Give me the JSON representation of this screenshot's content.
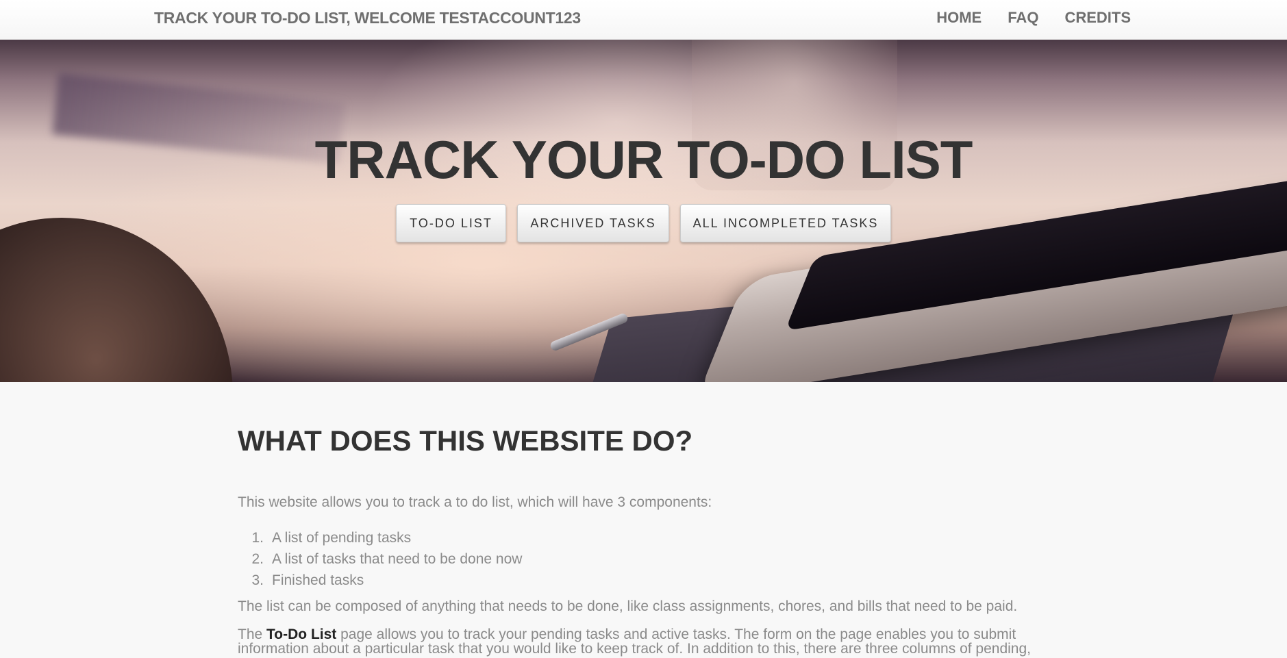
{
  "navbar": {
    "brand": "TRACK YOUR TO-DO LIST, WELCOME TESTACCOUNT123",
    "links": [
      "HOME",
      "FAQ",
      "CREDITS"
    ]
  },
  "hero": {
    "title": "TRACK YOUR TO-DO LIST",
    "buttons": [
      "TO-DO LIST",
      "ARCHIVED TASKS",
      "ALL INCOMPLETED TASKS"
    ]
  },
  "content": {
    "heading": "WHAT DOES THIS WEBSITE DO?",
    "intro": "This website allows you to track a to do list, which will have 3 components:",
    "list": [
      {
        "num": "1.",
        "text": "A list of pending tasks"
      },
      {
        "num": "2.",
        "text": "A list of tasks that need to be done now"
      },
      {
        "num": "3.",
        "text": "Finished tasks"
      }
    ],
    "compose": "The list can be composed of anything that needs to be done, like class assignments, chores, and bills that need to be paid.",
    "todo_para": {
      "prefix": "The ",
      "link": "To-Do List",
      "line1_rest": " page allows you to track your pending tasks and active tasks. The form on the page enables you to submit",
      "line2": "information about a particular task that you would like to keep track of. In addition to this, there are three columns of pending,"
    }
  },
  "colors": {
    "heading": "#333333",
    "body_text": "#8a8a8a",
    "nav_text": "#6f6f6f",
    "page_bg": "#f8f8f8"
  }
}
